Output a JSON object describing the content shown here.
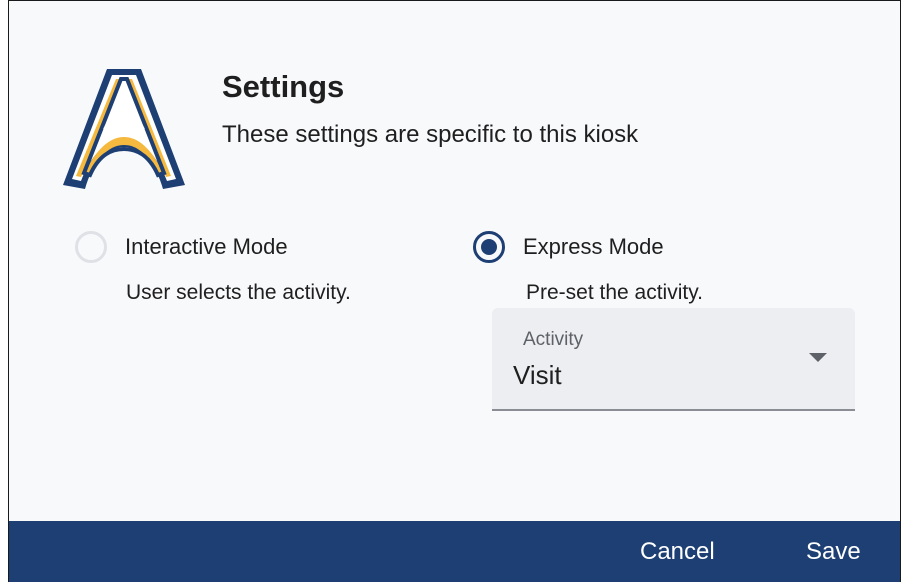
{
  "header": {
    "title": "Settings",
    "subtitle": "These settings are specific to this kiosk"
  },
  "modes": {
    "interactive": {
      "label": "Interactive Mode",
      "description": "User selects the activity.",
      "selected": false
    },
    "express": {
      "label": "Express Mode",
      "description": "Pre-set the activity.",
      "selected": true
    }
  },
  "activity": {
    "label": "Activity",
    "value": "Visit"
  },
  "footer": {
    "cancel_label": "Cancel",
    "save_label": "Save"
  },
  "colors": {
    "brand_navy": "#1d3f73",
    "brand_gold": "#f4b93e"
  }
}
